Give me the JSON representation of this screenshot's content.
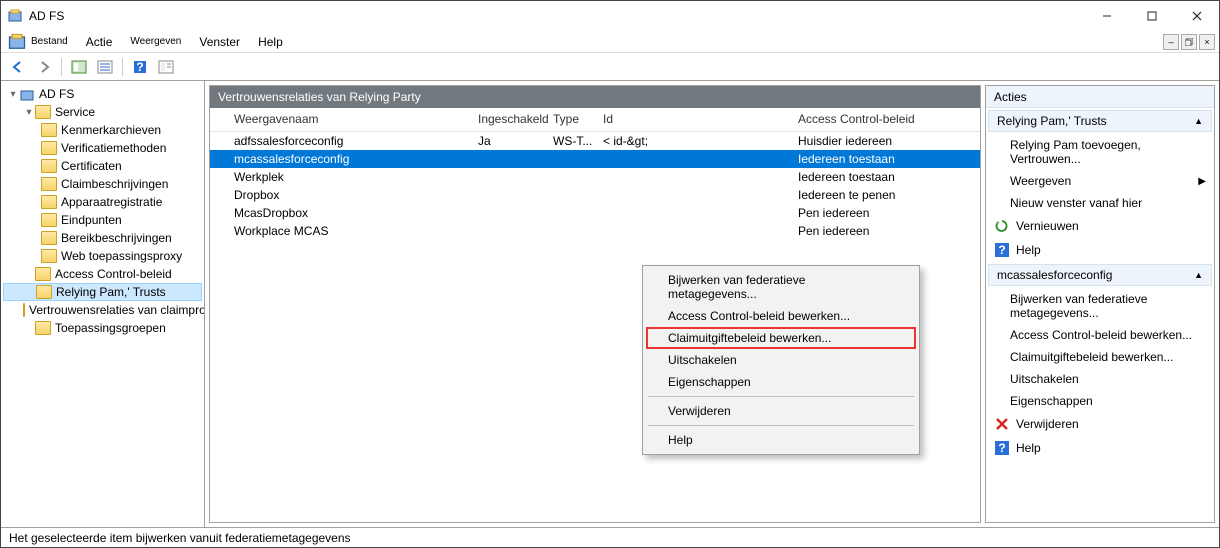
{
  "title": "AD FS",
  "menubar": {
    "file": "Bestand",
    "action": "Actie",
    "view": "Weergeven",
    "window": "Venster",
    "help": "Help"
  },
  "tree": {
    "root": "AD FS",
    "service": "Service",
    "items": [
      "Kenmerkarchieven",
      "Verificatiemethoden",
      "Certificaten",
      "Claimbeschrijvingen",
      "Apparaatregistratie",
      "Eindpunten",
      "Bereikbeschrijvingen",
      "Web toepassingsproxy"
    ],
    "below": [
      "Access Control-beleid",
      "Relying Pam,' Trusts",
      "Vertrouwensrelaties van claimprovider",
      "Toepassingsgroepen"
    ]
  },
  "center": {
    "title": "Vertrouwensrelaties van Relying Party",
    "cols": {
      "c1": "Weergavenaam",
      "c2": "Ingeschakeld",
      "c3": "Type",
      "c4": "Id",
      "c5": "Access Control-beleid"
    },
    "rows": [
      {
        "name": "adfssalesforceconfig",
        "enabled": "Ja",
        "type": "WS-T...",
        "id": "< id-&gt;",
        "acp": "Huisdier iedereen"
      },
      {
        "name": "mcassalesforceconfig",
        "enabled": "",
        "type": "",
        "id": "",
        "acp": "Iedereen toestaan",
        "selected": true
      },
      {
        "name": "Werkplek",
        "enabled": "",
        "type": "",
        "id": "",
        "acp": "Iedereen toestaan"
      },
      {
        "name": "Dropbox",
        "enabled": "",
        "type": "",
        "id": "",
        "acp": "Iedereen te penen"
      },
      {
        "name": "McasDropbox",
        "enabled": "",
        "type": "",
        "id": "",
        "acp": "Pen iedereen"
      },
      {
        "name": "Workplace MCAS",
        "enabled": "",
        "type": "",
        "id": "",
        "acp": "Pen iedereen"
      }
    ]
  },
  "ctx": {
    "i1": "Bijwerken van federatieve metagegevens...",
    "i2": "Access Control-beleid bewerken...",
    "i3": "Claimuitgiftebeleid bewerken...",
    "i4": "Uitschakelen",
    "i5": "Eigenschappen",
    "i6": "Verwijderen",
    "i7": "Help"
  },
  "actions": {
    "hdr": "Acties",
    "sec1": "Relying Pam,' Trusts",
    "a1": "Relying Pam toevoegen, Vertrouwen...",
    "a2": "Weergeven",
    "a3": "Nieuw venster vanaf hier",
    "a4": "Vernieuwen",
    "a5": "Help",
    "sec2": "mcassalesforceconfig",
    "b1": "Bijwerken van federatieve metagegevens...",
    "b2": "Access Control-beleid bewerken...",
    "b3": "Claimuitgiftebeleid bewerken...",
    "b4": "Uitschakelen",
    "b5": "Eigenschappen",
    "b6": "Verwijderen",
    "b7": "Help"
  },
  "status": "Het geselecteerde item bijwerken vanuit federatiemetagegevens"
}
